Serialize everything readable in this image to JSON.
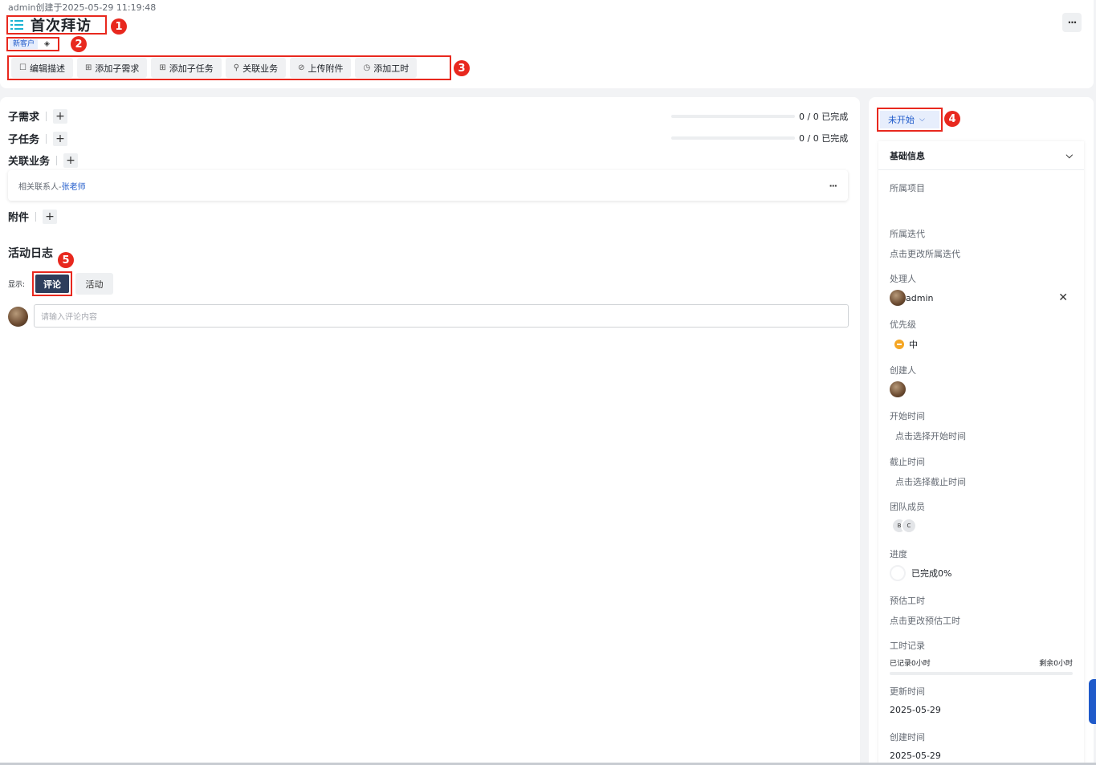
{
  "header": {
    "created_by": "admin创建于2025-05-29 11:19:48",
    "title": "首次拜访",
    "title_icon": "list-icon",
    "tag": "新客户",
    "tag_icon": "tag-icon",
    "more_label": "···",
    "actions": [
      {
        "icon": "edit-icon",
        "glyph": "☐",
        "label": "编辑描述"
      },
      {
        "icon": "add-requirement-icon",
        "glyph": "⊞",
        "label": "添加子需求"
      },
      {
        "icon": "add-task-icon",
        "glyph": "⊞",
        "label": "添加子任务"
      },
      {
        "icon": "link-icon",
        "glyph": "⚲",
        "label": "关联业务"
      },
      {
        "icon": "attachment-icon",
        "glyph": "⊘",
        "label": "上传附件"
      },
      {
        "icon": "clock-icon",
        "glyph": "◷",
        "label": "添加工时"
      }
    ]
  },
  "badges": [
    "1",
    "2",
    "3",
    "4",
    "5"
  ],
  "sections": {
    "sub_requirements": {
      "title": "子需求",
      "progress": 0,
      "progress_text": "0 / 0 已完成"
    },
    "sub_tasks": {
      "title": "子任务",
      "progress": 0,
      "progress_text": "0 / 0 已完成"
    },
    "related": {
      "title": "关联业务",
      "item_prefix": "相关联系人-",
      "item_link": "张老师",
      "more_label": "···"
    },
    "attachments": {
      "title": "附件"
    },
    "plus_label": "+"
  },
  "activity": {
    "title": "活动日志",
    "show_label": "显示:",
    "tabs": [
      "评论",
      "活动"
    ],
    "active_tab": "评论",
    "comment_placeholder": "请输入评论内容"
  },
  "sidebar": {
    "status": "未开始",
    "section_title": "基础信息",
    "fields": {
      "project": {
        "label": "所属项目",
        "value": ""
      },
      "iteration": {
        "label": "所属迭代",
        "value": "点击更改所属迭代"
      },
      "assignee": {
        "label": "处理人",
        "value": "admin",
        "clear": "✕"
      },
      "priority": {
        "label": "优先级",
        "value": "中",
        "color": "#f5a623"
      },
      "creator": {
        "label": "创建人"
      },
      "start_time": {
        "label": "开始时间",
        "value": "点击选择开始时间"
      },
      "end_time": {
        "label": "截止时间",
        "value": "点击选择截止时间"
      },
      "team": {
        "label": "团队成员",
        "members": [
          "B",
          "C"
        ]
      },
      "progress": {
        "label": "进度",
        "value": "已完成0%",
        "percent": 0
      },
      "estimate": {
        "label": "预估工时",
        "value": "点击更改预估工时"
      },
      "worklog": {
        "label": "工时记录",
        "recorded": "已记录0小时",
        "remaining": "剩余0小时"
      },
      "updated": {
        "label": "更新时间",
        "value": "2025-05-29"
      },
      "created": {
        "label": "创建时间",
        "value": "2025-05-29"
      }
    }
  },
  "colors": {
    "accent": "#1f5aca",
    "highlight": "#e8281e",
    "active_tab": "#2e3e5c"
  }
}
